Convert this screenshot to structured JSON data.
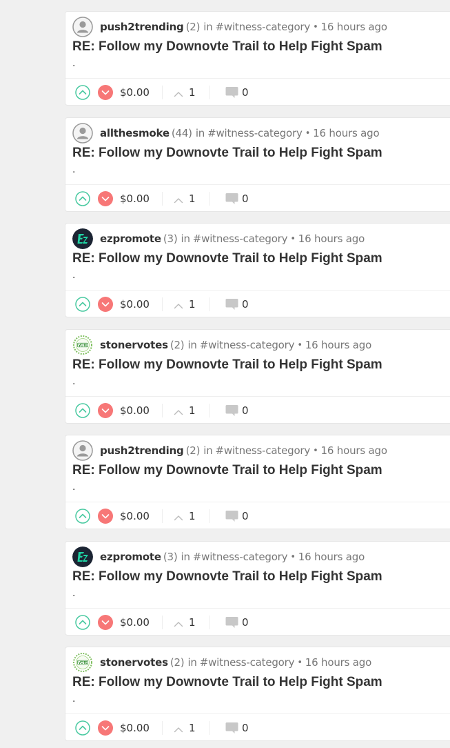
{
  "colors": {
    "upvote": "#48c9a0",
    "downvote": "#f77777",
    "page_background": "#f0f0f0",
    "ez_avatar_bg": "#1b2433",
    "ez_avatar_fg": "#1fd4a4",
    "vote_avatar_green": "#2e8b2e"
  },
  "posts": [
    {
      "avatar": "default-avatar",
      "author": "push2trending",
      "reputation": "(2)",
      "in_word": "in",
      "category": "#witness-category",
      "separator": "•",
      "time": "16 hours ago",
      "title": "RE: Follow my Downovte Trail to Help Fight Spam",
      "body": ".",
      "payout": "$0.00",
      "votes": "1",
      "replies": "0"
    },
    {
      "avatar": "default-avatar",
      "author": "allthesmoke",
      "reputation": "(44)",
      "in_word": "in",
      "category": "#witness-category",
      "separator": "•",
      "time": "16 hours ago",
      "title": "RE: Follow my Downovte Trail to Help Fight Spam",
      "body": ".",
      "payout": "$0.00",
      "votes": "1",
      "replies": "0"
    },
    {
      "avatar": "ez-logo-avatar",
      "author": "ezpromote",
      "reputation": "(3)",
      "in_word": "in",
      "category": "#witness-category",
      "separator": "•",
      "time": "16 hours ago",
      "title": "RE: Follow my Downovte Trail to Help Fight Spam",
      "body": ".",
      "payout": "$0.00",
      "votes": "1",
      "replies": "0"
    },
    {
      "avatar": "vote-badge-avatar",
      "author": "stonervotes",
      "reputation": "(2)",
      "in_word": "in",
      "category": "#witness-category",
      "separator": "•",
      "time": "16 hours ago",
      "title": "RE: Follow my Downovte Trail to Help Fight Spam",
      "body": ".",
      "payout": "$0.00",
      "votes": "1",
      "replies": "0"
    },
    {
      "avatar": "default-avatar",
      "author": "push2trending",
      "reputation": "(2)",
      "in_word": "in",
      "category": "#witness-category",
      "separator": "•",
      "time": "16 hours ago",
      "title": "RE: Follow my Downovte Trail to Help Fight Spam",
      "body": ".",
      "payout": "$0.00",
      "votes": "1",
      "replies": "0"
    },
    {
      "avatar": "ez-logo-avatar",
      "author": "ezpromote",
      "reputation": "(3)",
      "in_word": "in",
      "category": "#witness-category",
      "separator": "•",
      "time": "16 hours ago",
      "title": "RE: Follow my Downovte Trail to Help Fight Spam",
      "body": ".",
      "payout": "$0.00",
      "votes": "1",
      "replies": "0"
    },
    {
      "avatar": "vote-badge-avatar",
      "author": "stonervotes",
      "reputation": "(2)",
      "in_word": "in",
      "category": "#witness-category",
      "separator": "•",
      "time": "16 hours ago",
      "title": "RE: Follow my Downovte Trail to Help Fight Spam",
      "body": ".",
      "payout": "$0.00",
      "votes": "1",
      "replies": "0"
    }
  ]
}
